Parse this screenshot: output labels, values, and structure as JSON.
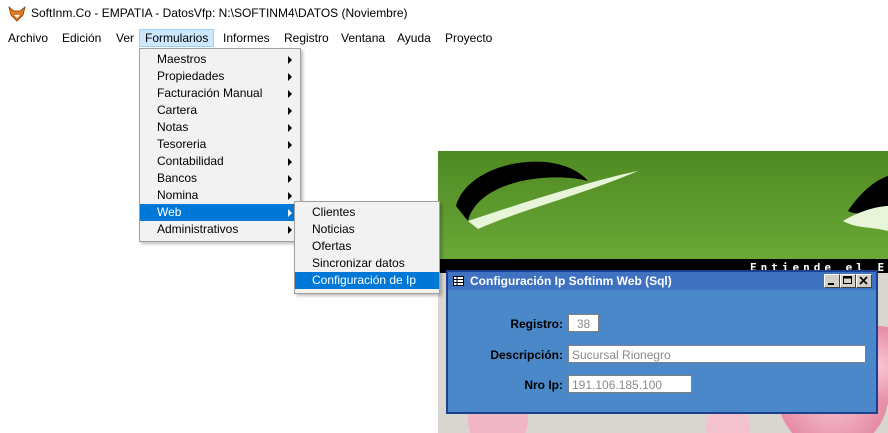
{
  "window": {
    "title": "SoftInm.Co - EMPATIA - DatosVfp: N:\\SOFTINM4\\DATOS  (Noviembre)"
  },
  "menubar": [
    "Archivo",
    "Edición",
    "Ver",
    "Formularios",
    "Informes",
    "Registro",
    "Ventana",
    "Ayuda",
    "Proyecto"
  ],
  "formularios_menu": [
    {
      "label": "Maestros",
      "has_submenu": true
    },
    {
      "label": "Propiedades",
      "has_submenu": true
    },
    {
      "label": "Facturación Manual",
      "has_submenu": true
    },
    {
      "label": "Cartera",
      "has_submenu": true
    },
    {
      "label": "Notas",
      "has_submenu": true
    },
    {
      "label": "Tesoreria",
      "has_submenu": true
    },
    {
      "label": "Contabilidad",
      "has_submenu": true
    },
    {
      "label": "Bancos",
      "has_submenu": true
    },
    {
      "label": "Nomina",
      "has_submenu": true
    },
    {
      "label": "Web",
      "has_submenu": true
    },
    {
      "label": "Administrativos",
      "has_submenu": true
    }
  ],
  "web_menu": [
    "Clientes",
    "Noticias",
    "Ofertas",
    "Sincronizar datos",
    "Configuración de Ip"
  ],
  "background_banner": {
    "text": "Entiende el E"
  },
  "dialog": {
    "title": "Configuración Ip Softinm Web  (Sql)",
    "fields": {
      "registro": {
        "label": "Registro:",
        "value": "38"
      },
      "descripcion": {
        "label": "Descripción:",
        "value": "Sucursal Rionegro"
      },
      "nro_ip": {
        "label": "Nro Ip:",
        "value": "191.106.185.100"
      }
    }
  },
  "colors": {
    "menu_highlight": "#0078d7",
    "dialog_bg": "#4a88c9",
    "dialog_title": "#3f72c0",
    "banner_green": "#5f9b2e"
  }
}
